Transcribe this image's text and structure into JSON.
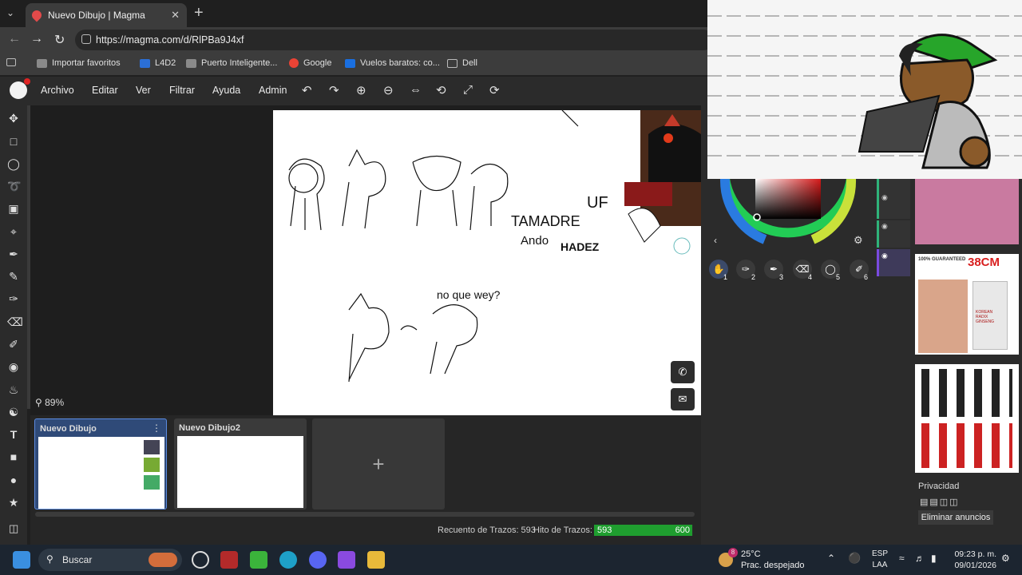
{
  "browser": {
    "tab_title": "Nuevo Dibujo | Magma",
    "url": "https://magma.com/d/RlPBa9J4xf",
    "bookmarks": [
      {
        "label": "Importar favoritos",
        "color": "#9aa0a6"
      },
      {
        "label": "L4D2",
        "color": "#2b6fd6"
      },
      {
        "label": "Puerto Inteligente...",
        "color": "#9aa0a6"
      },
      {
        "label": "Google",
        "color": "#ea4335"
      },
      {
        "label": "Vuelos baratos: co...",
        "color": "#1a6fe0"
      },
      {
        "label": "Dell",
        "color": "#9aa0a6"
      }
    ]
  },
  "app": {
    "menu": [
      "Archivo",
      "Editar",
      "Ver",
      "Filtrar",
      "Ayuda",
      "Admin"
    ],
    "zoom": "89%",
    "canvas_text": [
      "no que wey?",
      "TAMADRE",
      "Ando",
      "HADEZ",
      "UF"
    ],
    "drawings": [
      {
        "name": "Nuevo Dibujo"
      },
      {
        "name": "Nuevo Dibujo2"
      }
    ],
    "add_symbol": "+",
    "stroke_count_label": "Recuento de Trazos: 593",
    "stroke_hit_label": "Hito de Trazos:",
    "stroke_value": "593",
    "stroke_max": "600",
    "stroke_progress": 0.988,
    "brush_numbers": [
      "1",
      "2",
      "3",
      "4",
      "5",
      "6"
    ]
  },
  "ads": {
    "size_badge": "38CM",
    "guarantee": "100% GUARANTEED",
    "product": "KOREAN RADIX GINSENG",
    "privacy_label": "Privacidad",
    "remove_ads": "Eliminar anuncios"
  },
  "taskbar": {
    "search_placeholder": "Buscar",
    "weather_temp": "25°C",
    "weather_desc": "Prac. despejado",
    "weather_badge": "8",
    "lang_line1": "ESP",
    "lang_line2": "LAA",
    "time": "09:23 p. m.",
    "date": "09/01/2026"
  }
}
